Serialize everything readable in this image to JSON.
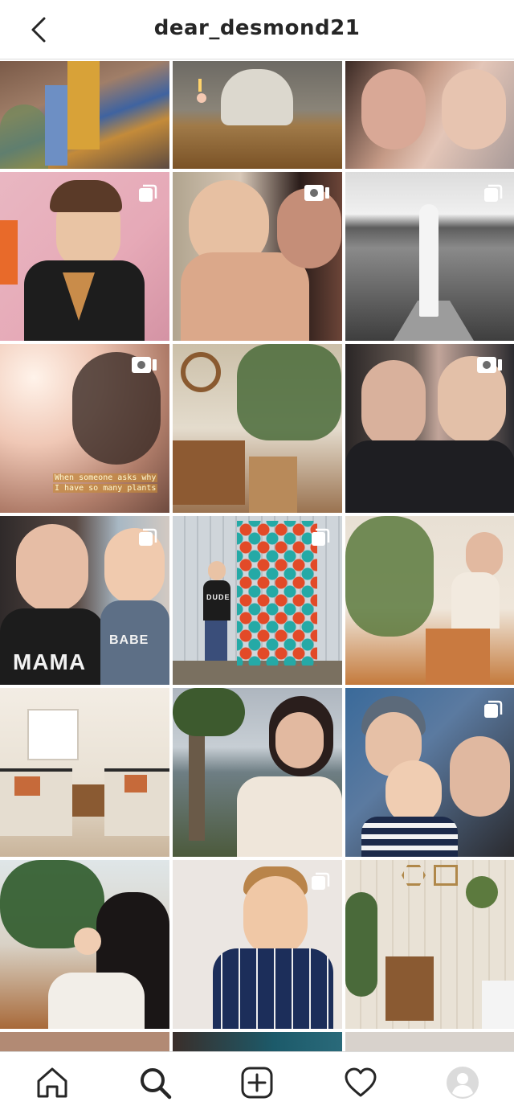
{
  "header": {
    "title": "dear_desmond21",
    "back_icon": "chevron-left-icon"
  },
  "grid": {
    "posts": [
      {
        "kind": "photo",
        "indicator": null
      },
      {
        "kind": "photo",
        "indicator": null
      },
      {
        "kind": "photo",
        "indicator": null
      },
      {
        "kind": "photo",
        "indicator": "carousel"
      },
      {
        "kind": "photo",
        "indicator": "video"
      },
      {
        "kind": "photo",
        "indicator": "carousel"
      },
      {
        "kind": "photo",
        "indicator": "video"
      },
      {
        "kind": "photo",
        "indicator": null
      },
      {
        "kind": "photo",
        "indicator": "video"
      },
      {
        "kind": "photo",
        "indicator": "carousel"
      },
      {
        "kind": "photo",
        "indicator": "carousel"
      },
      {
        "kind": "photo",
        "indicator": null
      },
      {
        "kind": "photo",
        "indicator": null
      },
      {
        "kind": "photo",
        "indicator": null
      },
      {
        "kind": "photo",
        "indicator": "carousel"
      },
      {
        "kind": "photo",
        "indicator": null
      },
      {
        "kind": "photo",
        "indicator": "carousel"
      },
      {
        "kind": "photo",
        "indicator": null
      }
    ],
    "overlay_texts": {
      "plants_caption_line1": "When someone asks why",
      "plants_caption_line2": "I have so many plants",
      "mama_shirt": "MAMA",
      "babe_shirt": "BABE",
      "dude_shirt": "DUDE"
    }
  },
  "bottom_nav": {
    "items": [
      {
        "name": "home",
        "icon": "home-icon"
      },
      {
        "name": "search",
        "icon": "search-icon",
        "active": true
      },
      {
        "name": "new-post",
        "icon": "plus-square-icon"
      },
      {
        "name": "activity",
        "icon": "heart-icon"
      },
      {
        "name": "profile",
        "icon": "avatar-icon"
      }
    ]
  },
  "colors": {
    "text_primary": "#262626",
    "divider": "#dbdbdb",
    "background": "#ffffff"
  }
}
